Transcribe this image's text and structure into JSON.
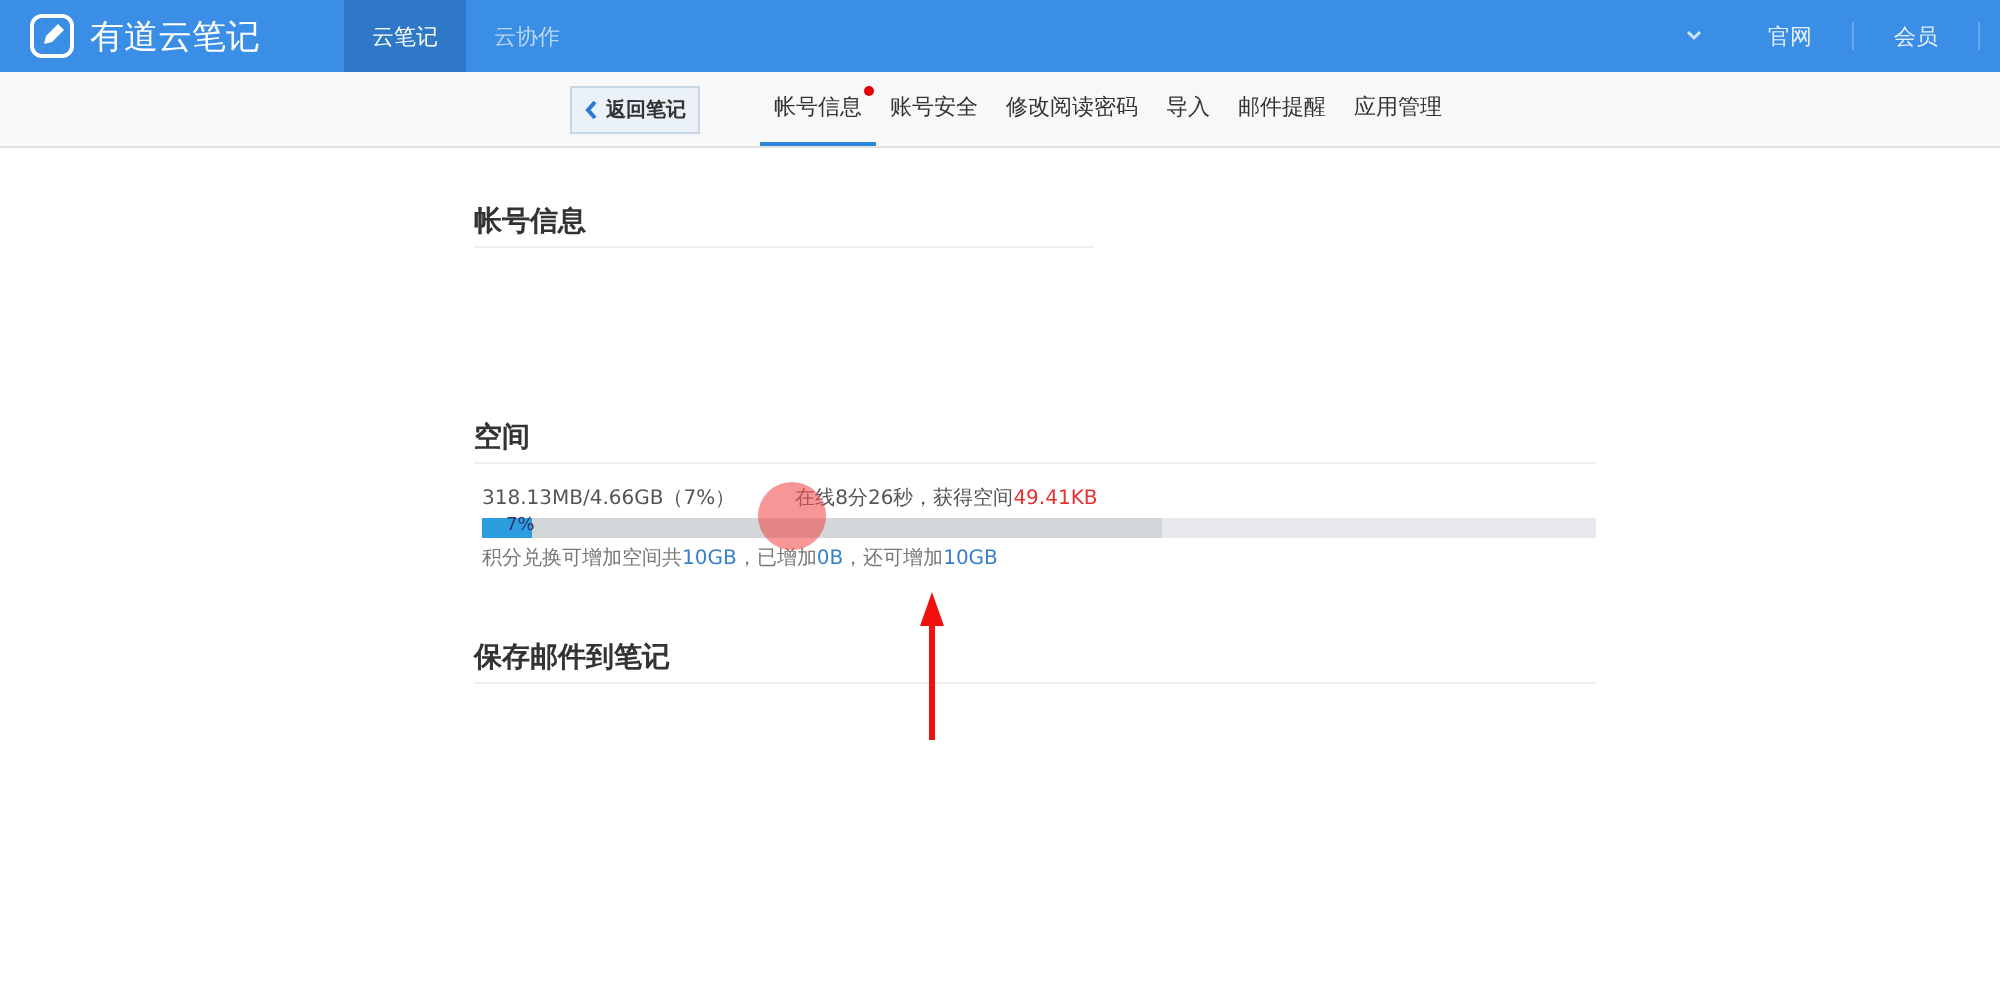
{
  "header": {
    "logo_text": "有道云笔记",
    "nav": [
      {
        "label": "云笔记",
        "selected": true
      },
      {
        "label": "云协作",
        "selected": false
      }
    ],
    "right_links": [
      "官网",
      "会员"
    ]
  },
  "subnav": {
    "back_button": "返回笔记",
    "tabs": [
      {
        "label": "帐号信息",
        "selected": true,
        "badge": true
      },
      {
        "label": "账号安全",
        "selected": false,
        "badge": false
      },
      {
        "label": "修改阅读密码",
        "selected": false,
        "badge": false
      },
      {
        "label": "导入",
        "selected": false,
        "badge": false
      },
      {
        "label": "邮件提醒",
        "selected": false,
        "badge": false
      },
      {
        "label": "应用管理",
        "selected": false,
        "badge": false
      }
    ]
  },
  "sections": [
    {
      "kind": "account",
      "title": "帐号信息"
    },
    {
      "kind": "space",
      "title": "空间",
      "usage": "318.13MB/4.66GB（7%）",
      "online": [
        {
          "text": "在线8分26秒，获得空间",
          "highlight": false
        },
        {
          "text": "49.41KB",
          "highlight": true
        }
      ],
      "bar": {
        "level": 0.045,
        "label": "7%"
      },
      "online_bar": {
        "level": 0.61
      },
      "note": [
        {
          "text": "积分兑换可增加空间共",
          "highlight": false
        },
        {
          "text": "10GB",
          "highlight": true
        },
        {
          "text": "，已增加",
          "highlight": false
        },
        {
          "text": "0B",
          "highlight": true
        },
        {
          "text": "，还可增加",
          "highlight": false
        },
        {
          "text": "10GB",
          "highlight": true
        }
      ]
    },
    {
      "kind": "mail",
      "title": "保存邮件到笔记"
    }
  ]
}
